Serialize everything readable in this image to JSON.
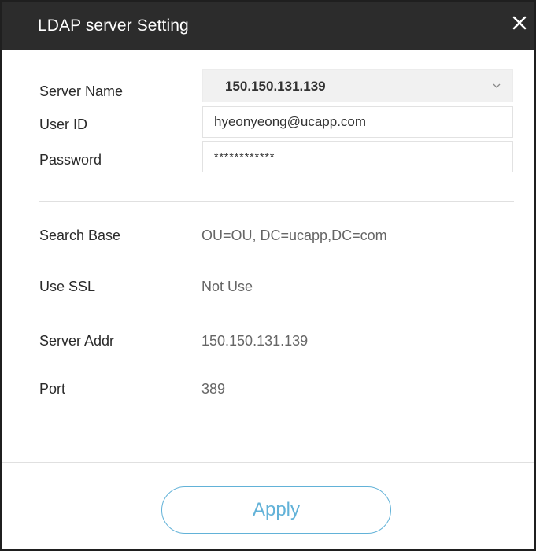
{
  "dialog": {
    "title": "LDAP server Setting",
    "close_icon": "close-icon"
  },
  "form": {
    "server_name": {
      "label": "Server Name",
      "selected": "150.150.131.139",
      "icon": "chevron-down-icon"
    },
    "user_id": {
      "label": "User ID",
      "value": "hyeonyeong@ucapp.com"
    },
    "password": {
      "label": "Password",
      "value": "************"
    }
  },
  "info": {
    "search_base": {
      "label": "Search Base",
      "value": "OU=OU, DC=ucapp,DC=com"
    },
    "use_ssl": {
      "label": "Use SSL",
      "value": "Not Use"
    },
    "server_addr": {
      "label": "Server Addr",
      "value": "150.150.131.139"
    },
    "port": {
      "label": "Port",
      "value": "389"
    }
  },
  "actions": {
    "apply_label": "Apply"
  },
  "colors": {
    "titlebar": "#2c2c2c",
    "accent": "#62b2d8",
    "select_bg": "#f1f1f1"
  }
}
